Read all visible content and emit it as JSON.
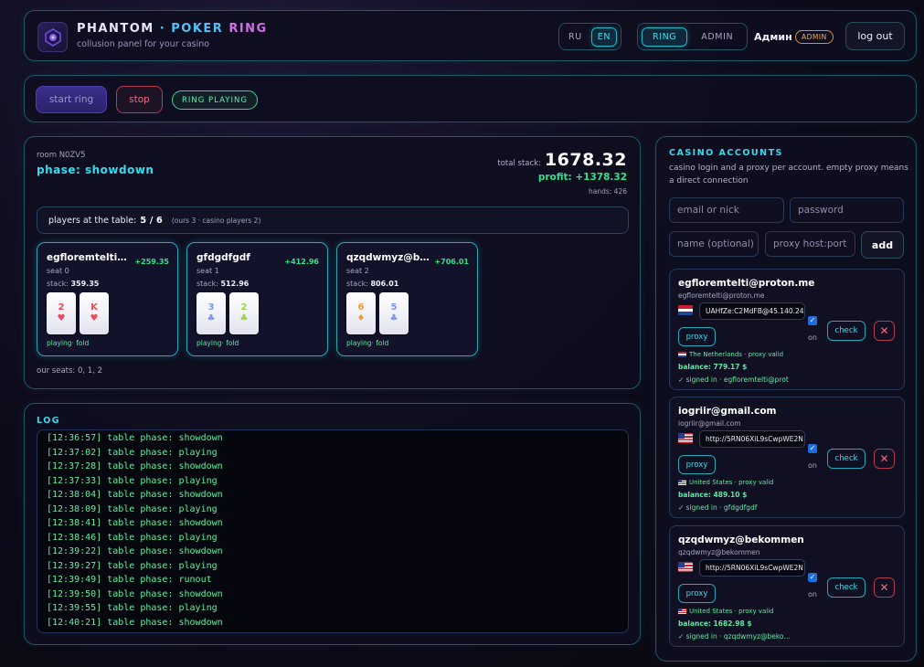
{
  "header": {
    "brand_main": "PHANTOM",
    "brand_sep": "·",
    "brand_poker": "POKER",
    "brand_ring": "RING",
    "subtitle": "collusion panel for your casino",
    "lang_ru": "RU",
    "lang_en": "EN",
    "mode_ring": "RING",
    "mode_admin": "ADMIN",
    "user": "Админ",
    "role": "ADMIN",
    "logout": "log out"
  },
  "controls": {
    "start": "start ring",
    "stop": "stop",
    "status": "RING PLAYING"
  },
  "room": {
    "id": "room N0ZV5",
    "phase": "phase: showdown",
    "total_label": "total stack:",
    "total_value": "1678.32",
    "profit": "profit: +1378.32",
    "hands": "hands: 426",
    "players_label": "players at the table:",
    "players_value": "5 / 6",
    "players_extra": "(ours 3 · casino players 2)",
    "seats": [
      {
        "name": "egfloremtelti@pr...",
        "profit": "+259.35",
        "seat": "seat 0",
        "stack_label": "stack:",
        "stack": "359.35",
        "state": "playing· fold",
        "cards": [
          {
            "rank": "2",
            "suit": "♥",
            "color": "#e84b5c"
          },
          {
            "rank": "K",
            "suit": "♥",
            "color": "#e84b5c"
          }
        ]
      },
      {
        "name": "gfdgdfgdf",
        "profit": "+412.96",
        "seat": "seat 1",
        "stack_label": "stack:",
        "stack": "512.96",
        "state": "playing· fold",
        "cards": [
          {
            "rank": "3",
            "suit": "♣",
            "color": "#7e96e8"
          },
          {
            "rank": "2",
            "suit": "♣",
            "color": "#9bd442"
          }
        ]
      },
      {
        "name": "qzqdwmyz@beko...",
        "profit": "+706.01",
        "seat": "seat 2",
        "stack_label": "stack:",
        "stack": "806.01",
        "state": "playing· fold",
        "cards": [
          {
            "rank": "6",
            "suit": "♦",
            "color": "#f39a3a"
          },
          {
            "rank": "5",
            "suit": "♣",
            "color": "#7e96e8"
          }
        ]
      }
    ],
    "our_seats": "our seats: 0, 1, 2"
  },
  "log": {
    "title": "LOG",
    "lines": [
      "[12:36:57] table phase: showdown",
      "[12:37:02] table phase: playing",
      "[12:37:28] table phase: showdown",
      "[12:37:33] table phase: playing",
      "[12:38:04] table phase: showdown",
      "[12:38:09] table phase: playing",
      "[12:38:41] table phase: showdown",
      "[12:38:46] table phase: playing",
      "[12:39:22] table phase: showdown",
      "[12:39:27] table phase: playing",
      "[12:39:49] table phase: runout",
      "[12:39:50] table phase: showdown",
      "[12:39:55] table phase: playing",
      "[12:40:21] table phase: showdown"
    ]
  },
  "accounts": {
    "title": "CASINO ACCOUNTS",
    "desc": "casino login and a proxy per account. empty proxy means a direct connection",
    "ph_email": "email or nick",
    "ph_password": "password",
    "ph_name": "name (optional)",
    "ph_proxy": "proxy host:port",
    "add": "add",
    "items": [
      {
        "name": "egfloremtelti@proton.me",
        "login": "egfloremtelti@proton.me",
        "proxy": "UAHfZe:C2MdFB@45.140.249.",
        "flag": "nl",
        "proxy_btn": "proxy",
        "on": "on",
        "check": "check",
        "del": "✕",
        "location": "The Netherlands · proxy valid",
        "balance": "balance: 779.17 $",
        "signed": "✓ signed in · egfloremtelti@prot"
      },
      {
        "name": "iogriir@gmail.com",
        "login": "iogriir@gmail.com",
        "proxy": "http://5RN06XiL9sCwpWE2N",
        "flag": "us",
        "proxy_btn": "proxy",
        "on": "on",
        "check": "check",
        "del": "✕",
        "location": "United States · proxy valid",
        "balance": "balance: 489.10 $",
        "signed": "✓ signed in · gfdgdfgdf"
      },
      {
        "name": "qzqdwmyz@bekommen",
        "login": "qzqdwmyz@bekommen",
        "proxy": "http://5RN06XiL9sCwpWE2N",
        "flag": "us",
        "proxy_btn": "proxy",
        "on": "on",
        "check": "check",
        "del": "✕",
        "location": "United States · proxy valid",
        "balance": "balance: 1682.98 $",
        "signed": "✓ signed in · qzqdwmyz@bekomm..."
      }
    ]
  }
}
